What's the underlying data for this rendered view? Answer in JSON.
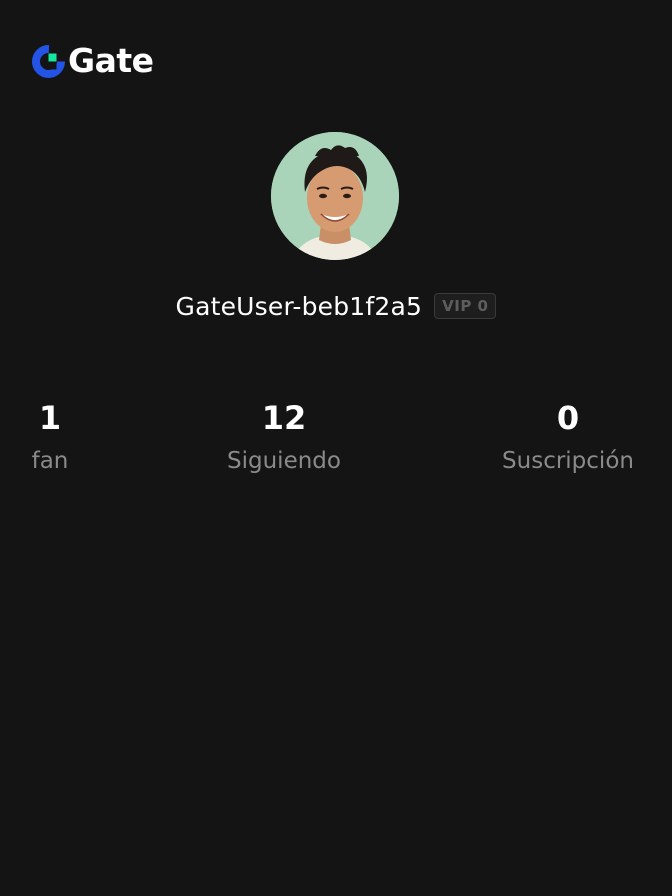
{
  "brand": {
    "name": "Gate",
    "icon": "gate-logo-icon",
    "colors": {
      "blue": "#2354e6",
      "green": "#17e6a1"
    }
  },
  "profile": {
    "avatar_alt": "user-avatar",
    "username": "GateUser-beb1f2a5",
    "vip_label": "VIP 0"
  },
  "stats": [
    {
      "value": "1",
      "label": "fan"
    },
    {
      "value": "12",
      "label": "Siguiendo"
    },
    {
      "value": "0",
      "label": "Suscripción"
    }
  ]
}
